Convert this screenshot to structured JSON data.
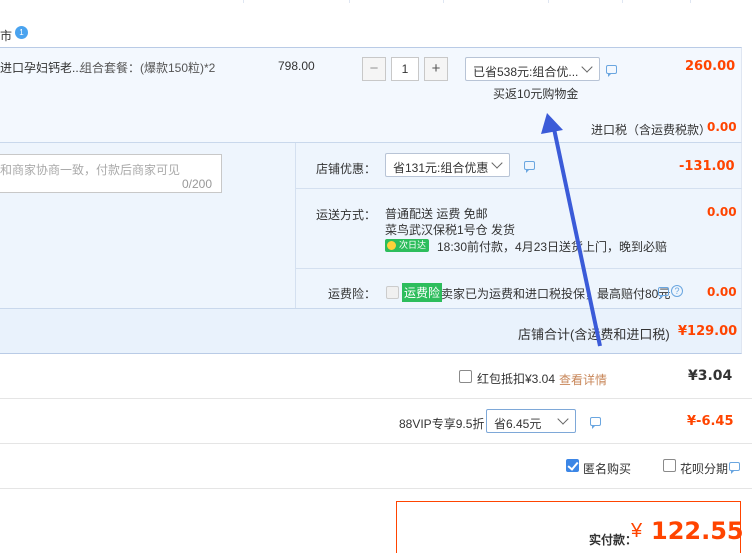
{
  "shop": {
    "name_fragment": "市",
    "badge": "1"
  },
  "item": {
    "title_fragment": "进口孕妇钙老...",
    "sku": "组合套餐：(爆款150粒)*2",
    "unit_price": "798.00",
    "qty_minus": "−",
    "qty": "1",
    "qty_plus": "+",
    "promo_select": "已省538元:组合优...",
    "rebate": "买返10元购物金",
    "subtotal": "260.00"
  },
  "import_tax": {
    "label": "进口税（含运费税款）",
    "value": "0.00"
  },
  "message": {
    "placeholder": "和商家协商一致，付款后商家可见",
    "counter": "0/200"
  },
  "shop_discount": {
    "label": "店铺优惠：",
    "select": "省131元:组合优惠",
    "value": "-131.00"
  },
  "shipping": {
    "label": "运送方式：",
    "line1": "普通配送 运费 免邮",
    "line2": "菜鸟武汉保税1号仓   发货",
    "tag": "次日达",
    "line3": "18:30前付款，4月23日送货上门，晚到必赔",
    "value": "0.00"
  },
  "insurance": {
    "label": "运费险：",
    "tag": "运费险",
    "text": "卖家已为运费和进口税投保，最高赔付80元",
    "value": "0.00"
  },
  "shop_total": {
    "label": "店铺合计(含运费和进口税)",
    "value": "¥129.00"
  },
  "red_packet": {
    "label": "红包抵扣¥3.04",
    "link": "查看详情",
    "value": "¥3.04"
  },
  "vip": {
    "label": "88VIP专享9.5折",
    "select": "省6.45元",
    "value": "¥-6.45"
  },
  "options": {
    "anonymous": "匿名购买",
    "installment": "花呗分期"
  },
  "payment": {
    "label": "实付款：",
    "currency": "¥",
    "amount": "122.55"
  },
  "colors": {
    "accent": "#f40",
    "border_blue": "#dfe6f2",
    "row_bg": "#f3f8fe",
    "arrow": "#3b5bd8"
  }
}
